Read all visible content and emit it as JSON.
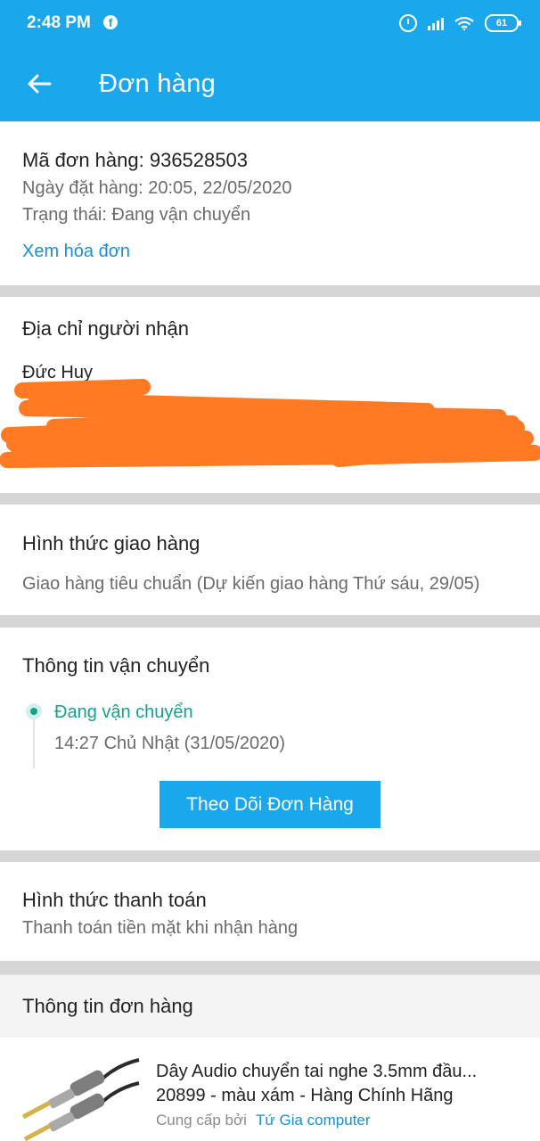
{
  "status_bar": {
    "time": "2:48 PM",
    "facebook_icon": "f",
    "battery_level": "61"
  },
  "app_bar": {
    "back_icon": "arrow-left",
    "title": "Đơn hàng"
  },
  "order_summary": {
    "order_code": "Mã đơn hàng: 936528503",
    "order_date": "Ngày đặt hàng: 20:05, 22/05/2020",
    "order_status": "Trạng thái: Đang vận chuyển",
    "view_invoice_link": "Xem hóa đơn"
  },
  "recipient": {
    "heading": "Địa chỉ người nhận",
    "name": "Đức Huy"
  },
  "delivery_method": {
    "heading": "Hình thức giao hàng",
    "detail": "Giao hàng tiêu chuẩn (Dự kiến giao hàng Thứ sáu, 29/05)"
  },
  "shipping_info": {
    "heading": "Thông tin vận chuyển",
    "status": "Đang vận chuyển",
    "timestamp": "14:27 Chủ Nhật (31/05/2020)",
    "track_button": "Theo Dõi Đơn Hàng"
  },
  "payment_method": {
    "heading": "Hình thức thanh toán",
    "detail": "Thanh toán tiền mặt khi nhận hàng"
  },
  "order_info": {
    "heading": "Thông tin đơn hàng",
    "product_line1": "Dây Audio chuyển tai nghe 3.5mm đầu...",
    "product_line2": "20899 - màu xám - Hàng Chính Hãng",
    "provider_prefix": "Cung cấp bởi",
    "provider_name": "Tứ Gia computer"
  },
  "colors": {
    "primary": "#1aa7ec",
    "link": "#1a8fd6",
    "status_green": "#17a08c",
    "redaction": "#ff7a22"
  }
}
